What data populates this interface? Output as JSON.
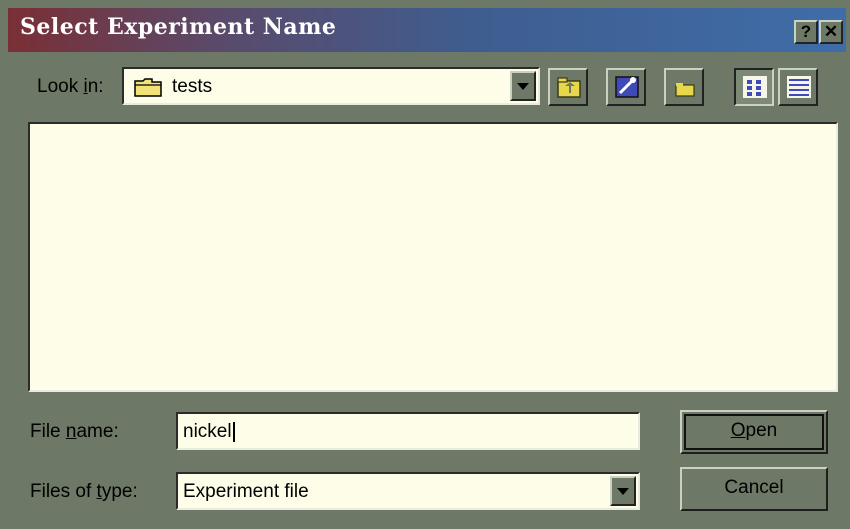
{
  "dialog": {
    "title": "Select Experiment Name",
    "help_label": "?",
    "close_label": "✕"
  },
  "lookin": {
    "label_pre": "Look ",
    "label_accel": "i",
    "label_post": "n:",
    "value": "tests"
  },
  "toolbar": {
    "icons": [
      "up-one-level-icon",
      "desktop-icon",
      "create-new-folder-icon",
      "list-view-icon",
      "details-view-icon"
    ]
  },
  "filename": {
    "label_pre": "File ",
    "label_accel": "n",
    "label_post": "ame:",
    "value": "nickel"
  },
  "filetype": {
    "label_pre": "Files of ",
    "label_accel": "t",
    "label_post": "ype:",
    "value": "Experiment file"
  },
  "buttons": {
    "open_accel": "O",
    "open_rest": "pen",
    "cancel": "Cancel"
  },
  "colors": {
    "dialog_bg": "#6d7866",
    "field_bg": "#fdfde8",
    "title_gradient_start": "#7a2f35",
    "title_gradient_end": "#3f6da8"
  }
}
